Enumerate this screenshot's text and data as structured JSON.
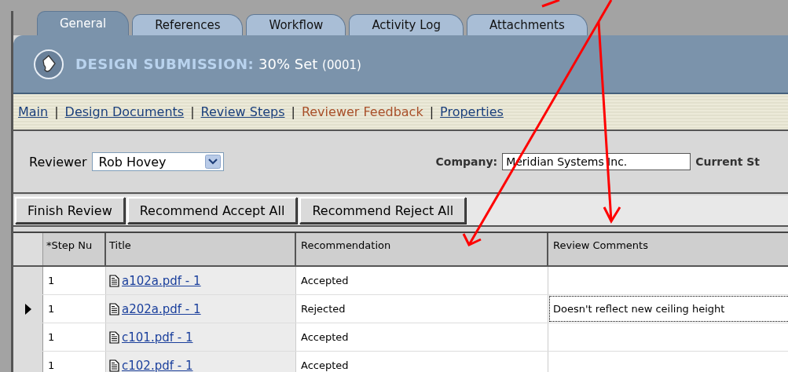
{
  "tabs": [
    {
      "label": "General",
      "selected": true
    },
    {
      "label": "References",
      "selected": false
    },
    {
      "label": "Workflow",
      "selected": false
    },
    {
      "label": "Activity Log",
      "selected": false
    },
    {
      "label": "Attachments",
      "selected": false
    }
  ],
  "header": {
    "title": "DESIGN SUBMISSION:",
    "name": "30% Set",
    "number": "(0001)"
  },
  "links": [
    {
      "label": "Main",
      "selected": false
    },
    {
      "label": "Design Documents",
      "selected": false
    },
    {
      "label": "Review Steps",
      "selected": false
    },
    {
      "label": "Reviewer Feedback",
      "selected": true
    },
    {
      "label": "Properties",
      "selected": false
    }
  ],
  "link_separator": "|",
  "reviewer": {
    "label": "Reviewer",
    "value": "Rob Hovey"
  },
  "company": {
    "label": "Company:",
    "value": "Meridian Systems Inc."
  },
  "current_status_label": "Current St",
  "buttons": [
    "Finish Review",
    "Recommend Accept All",
    "Recommend Reject All"
  ],
  "table": {
    "columns": [
      "*Step Nu",
      "Title",
      "Recommendation",
      "Review Comments"
    ],
    "rows": [
      {
        "step": "1",
        "title": "a102a.pdf - 1",
        "recommendation": "Accepted",
        "comment": "",
        "selected": false
      },
      {
        "step": "1",
        "title": "a202a.pdf - 1",
        "recommendation": "Rejected",
        "comment": "Doesn't reflect new ceiling height",
        "selected": true
      },
      {
        "step": "1",
        "title": "c101.pdf - 1",
        "recommendation": "Accepted",
        "comment": "",
        "selected": false
      },
      {
        "step": "1",
        "title": "c102.pdf - 1",
        "recommendation": "Accepted",
        "comment": "",
        "selected": false
      }
    ]
  }
}
